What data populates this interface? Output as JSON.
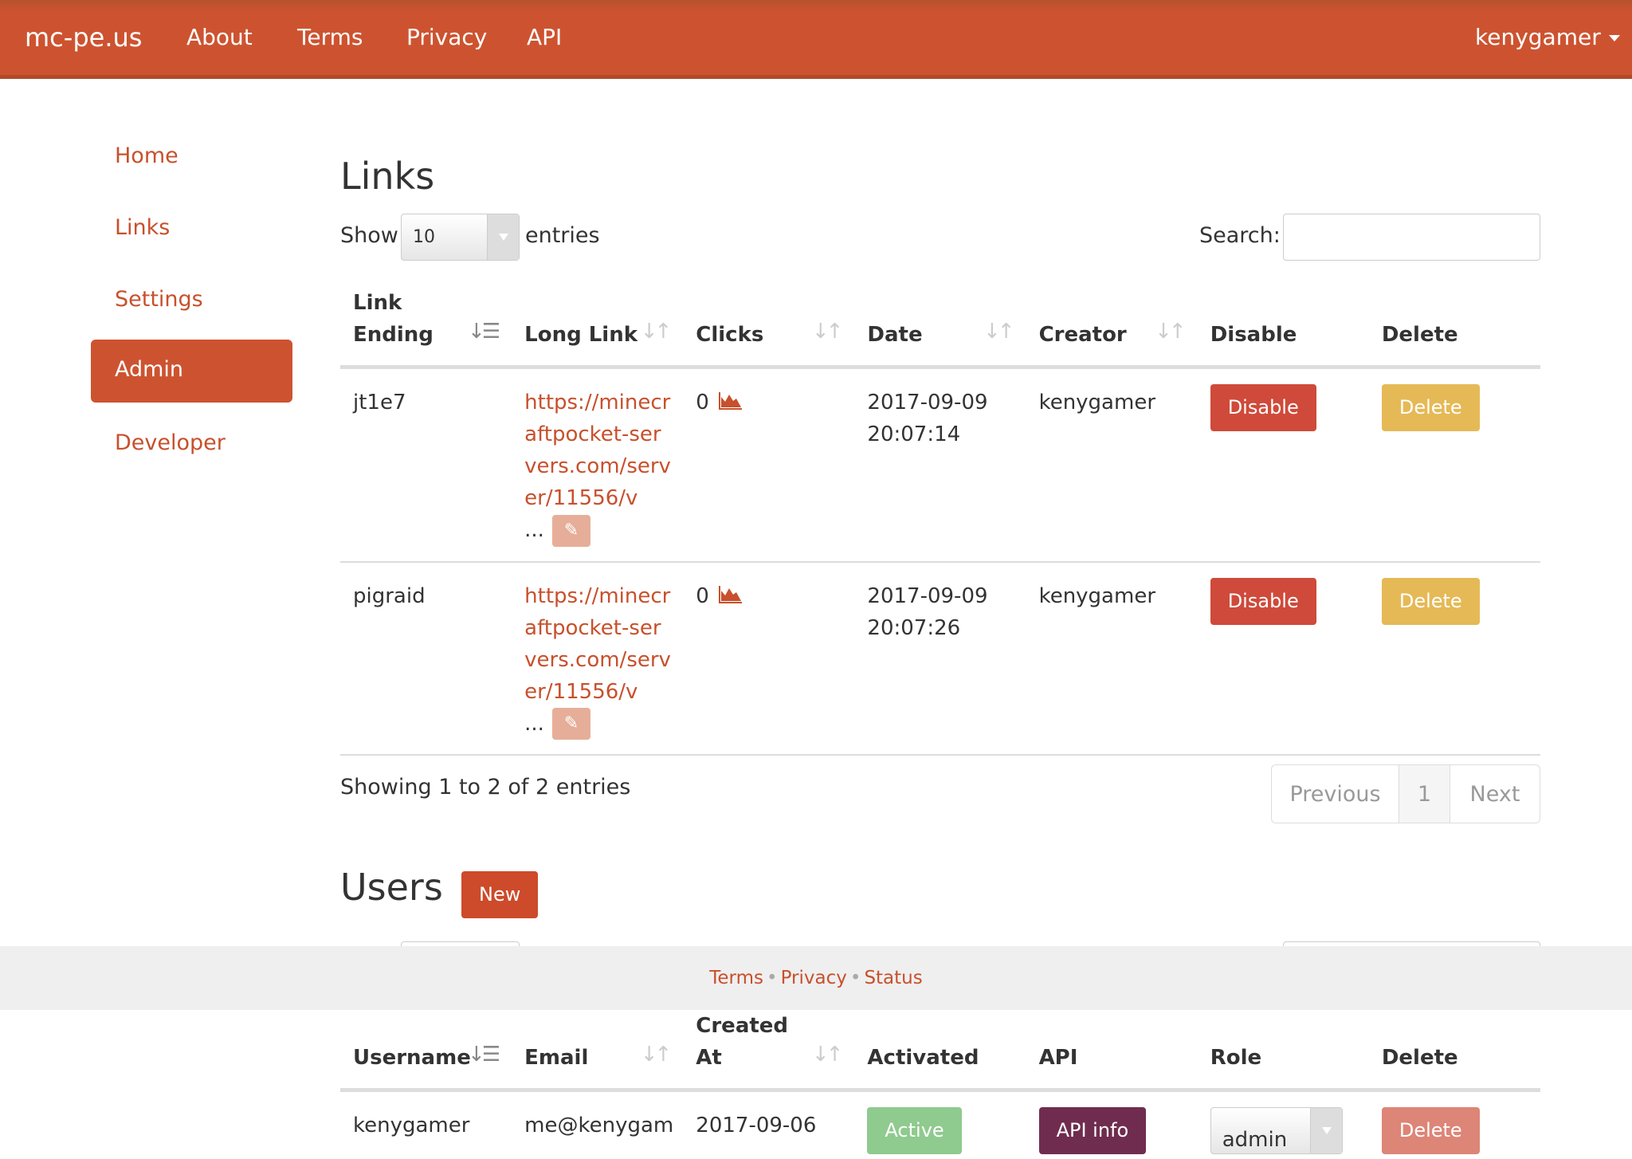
{
  "navbar": {
    "brand": "mc-pe.us",
    "links": [
      "About",
      "Terms",
      "Privacy",
      "API"
    ],
    "user": "kenygamer"
  },
  "sidebar": {
    "items": [
      "Home",
      "Links",
      "Settings",
      "Admin",
      "Developer"
    ],
    "active": "Admin"
  },
  "links_section": {
    "title": "Links",
    "show_label": "Show",
    "page_size": "10",
    "entries_label": "entries",
    "search_label": "Search:",
    "search_value": "",
    "columns": [
      "Link Ending",
      "Long Link",
      "Clicks",
      "Date",
      "Creator",
      "Disable",
      "Delete"
    ],
    "rows": [
      {
        "ending": "jt1e7",
        "long_link": "https://minecraftpocket-servers.com/server/11556/v",
        "ellipsis": "...",
        "clicks": "0",
        "date": "2017-09-09",
        "time": "20:07:14",
        "creator": "kenygamer",
        "disable": "Disable",
        "delete": "Delete"
      },
      {
        "ending": "pigraid",
        "long_link": "https://minecraftpocket-servers.com/server/11556/v",
        "ellipsis": "...",
        "clicks": "0",
        "date": "2017-09-09",
        "time": "20:07:26",
        "creator": "kenygamer",
        "disable": "Disable",
        "delete": "Delete"
      }
    ],
    "info": "Showing 1 to 2 of 2 entries",
    "pagination": {
      "previous": "Previous",
      "page": "1",
      "next": "Next"
    }
  },
  "users_section": {
    "title": "Users",
    "new_label": "New",
    "columns": [
      "Username",
      "Email",
      "Created At",
      "Activated",
      "API",
      "Role",
      "Delete"
    ],
    "rows": [
      {
        "username": "kenygamer",
        "email": "me@kenygam",
        "created": "2017-09-06",
        "activated": "Active",
        "api": "API info",
        "role": "admin",
        "delete": "Delete"
      }
    ]
  },
  "footer": {
    "links": [
      "Terms",
      "Privacy",
      "Status"
    ]
  },
  "colors": {
    "brand": "#cd5330",
    "danger": "#cf4a3a",
    "warning": "#e5b956",
    "success": "#8fca8f",
    "api": "#6f2c4f"
  }
}
